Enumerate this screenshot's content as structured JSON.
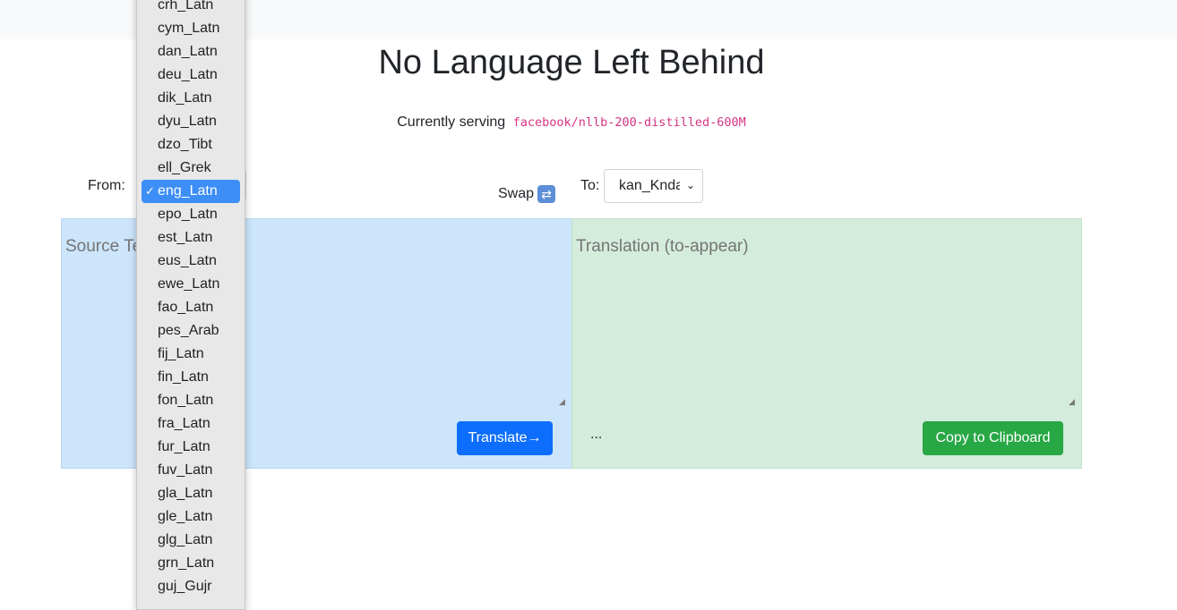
{
  "header": {
    "title": "No Language Left Behind",
    "serving_prefix": "Currently serving",
    "model_name": "facebook/nllb-200-distilled-600M"
  },
  "controls": {
    "from_label": "From:",
    "swap_label": "Swap",
    "swap_icon": "swap-icon",
    "to_label": "To:",
    "to_value": "kan_Knda"
  },
  "source": {
    "placeholder": "Source Text",
    "translate_label": "Translate→"
  },
  "target": {
    "placeholder": "Translation (to-appear)",
    "status": "...",
    "copy_label": "Copy to Clipboard"
  },
  "dropdown": {
    "selected": "eng_Latn",
    "check": "✓",
    "items": [
      "crh_Latn",
      "cym_Latn",
      "dan_Latn",
      "deu_Latn",
      "dik_Latn",
      "dyu_Latn",
      "dzo_Tibt",
      "ell_Grek",
      "eng_Latn",
      "epo_Latn",
      "est_Latn",
      "eus_Latn",
      "ewe_Latn",
      "fao_Latn",
      "pes_Arab",
      "fij_Latn",
      "fin_Latn",
      "fon_Latn",
      "fra_Latn",
      "fur_Latn",
      "fuv_Latn",
      "gla_Latn",
      "gle_Latn",
      "glg_Latn",
      "grn_Latn",
      "guj_Gujr"
    ]
  }
}
